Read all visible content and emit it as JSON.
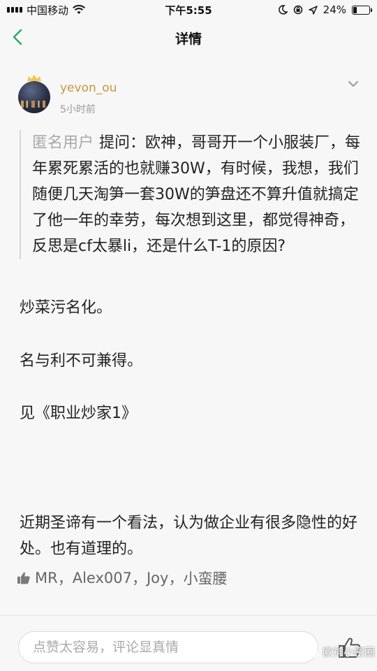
{
  "status_bar": {
    "carrier": "中国移动",
    "time": "下午5:55",
    "battery": "24%",
    "battery_level": 0.24
  },
  "nav": {
    "title": "详情"
  },
  "post": {
    "username": "yevon_ou",
    "time_ago": "5小时前",
    "quote_author": "匿名用户",
    "quote_text": "提问：欧神，哥哥开一个小服装厂，每年累死累活的也就赚30W，有时候，我想，我们随便几天淘笋一套30W的笋盘还不算升值就搞定了他一年的幸劳，每次想到这里，都觉得神奇，反思是cf太暴li，还是什么T-1的原因?",
    "paragraphs": [
      "炒菜污名化。",
      "名与利不可兼得。",
      "见《职业炒家1》",
      "近期圣谛有一个看法，认为做企业有很多隐性的好处。也有道理的。"
    ],
    "likes": [
      "MR",
      "Alex007",
      "Joy",
      "小蛮腰"
    ],
    "like_separator": "，"
  },
  "comment_bar": {
    "placeholder": "点赞太容易，评论显真情"
  },
  "watermark": "欧神小密圈"
}
